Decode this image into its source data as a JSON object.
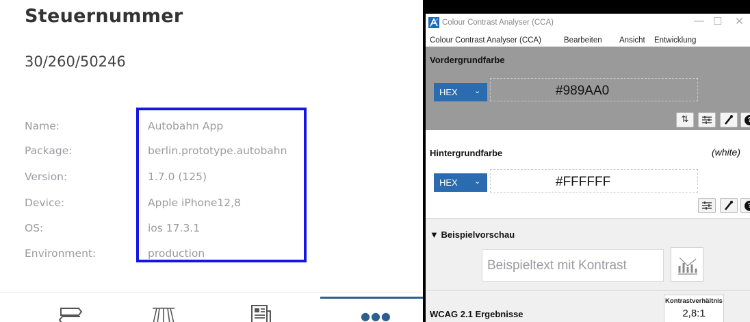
{
  "app": {
    "title": "Steuernummer",
    "number": "30/260/50246",
    "info": [
      {
        "label": "Name:",
        "value": "Autobahn App"
      },
      {
        "label": "Package:",
        "value": "berlin.prototype.autobahn"
      },
      {
        "label": "Version:",
        "value": "1.7.0 (125)"
      },
      {
        "label": "Device:",
        "value": "Apple iPhone12,8"
      },
      {
        "label": "OS:",
        "value": "ios 17.3.1"
      },
      {
        "label": "Environment:",
        "value": "production"
      }
    ],
    "more_dots": "●●●",
    "highlight_color": "#1515e6",
    "accent_color": "#2b5f8f",
    "nav_icons": [
      "route-icon",
      "roadworks-icon",
      "news-icon",
      "more-icon"
    ]
  },
  "cca": {
    "window_title": "Colour Contrast Analyser (CCA)",
    "window_controls": {
      "minimize": "—",
      "maximize": "☐",
      "close": "✕"
    },
    "menu": [
      "Colour Contrast Analyser (CCA)",
      "Bearbeiten",
      "Ansicht",
      "Entwicklung"
    ],
    "foreground": {
      "heading": "Vordergrundfarbe",
      "format": "HEX",
      "value": "#989AA0",
      "swatch": "#9a9a9a"
    },
    "background": {
      "heading": "Hintergrundfarbe",
      "name": "(white)",
      "format": "HEX",
      "value": "#FFFFFF"
    },
    "preview": {
      "heading": "▼ Beispielvorschau",
      "sample_text": "Beispieltext mit Kontrast"
    },
    "results": {
      "heading": "WCAG 2.1 Ergebnisse",
      "ratio_label": "Kontrastverhältnis",
      "ratio_value": "2,8:1"
    },
    "icons": {
      "swap": "⇅",
      "sliders": "☰",
      "help": "?"
    }
  }
}
